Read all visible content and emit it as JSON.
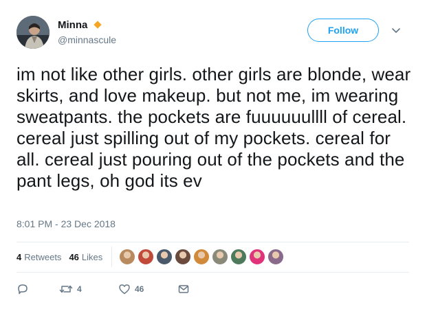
{
  "user": {
    "display_name": "Minna",
    "handle": "@minnascule",
    "verified_badge_icon": "diamond-badge-icon",
    "badge_color": "#f5a623"
  },
  "follow_button": {
    "label": "Follow"
  },
  "menu_icon": "chevron-down-icon",
  "tweet": {
    "text": "im not like other girls. other girls are blonde, wear skirts, and love makeup. but not me, im wearing sweatpants. the pockets are fuuuuuullll of cereal. cereal just spilling out of my pockets. cereal for all. cereal just pouring out of the pockets and the pant legs, oh god its ev",
    "timestamp": "8:01 PM - 23 Dec 2018"
  },
  "stats": {
    "retweets_count": "4",
    "retweets_label": "Retweets",
    "likes_count": "46",
    "likes_label": "Likes"
  },
  "likers": [
    {
      "color": "#b98a5e"
    },
    {
      "color": "#c24a3a"
    },
    {
      "color": "#4a5a6a"
    },
    {
      "color": "#6b4b3e"
    },
    {
      "color": "#d08a3a"
    },
    {
      "color": "#8a8a7a"
    },
    {
      "color": "#4c7a5a"
    },
    {
      "color": "#e0337a"
    },
    {
      "color": "#8a6a8a"
    }
  ],
  "actions": {
    "reply_icon": "reply-icon",
    "retweet_icon": "retweet-icon",
    "retweet_count": "4",
    "like_icon": "heart-icon",
    "like_count": "46",
    "dm_icon": "envelope-icon"
  },
  "colors": {
    "accent": "#1da1f2",
    "text": "#14171a",
    "muted": "#657786",
    "divider": "#e6ecf0"
  }
}
